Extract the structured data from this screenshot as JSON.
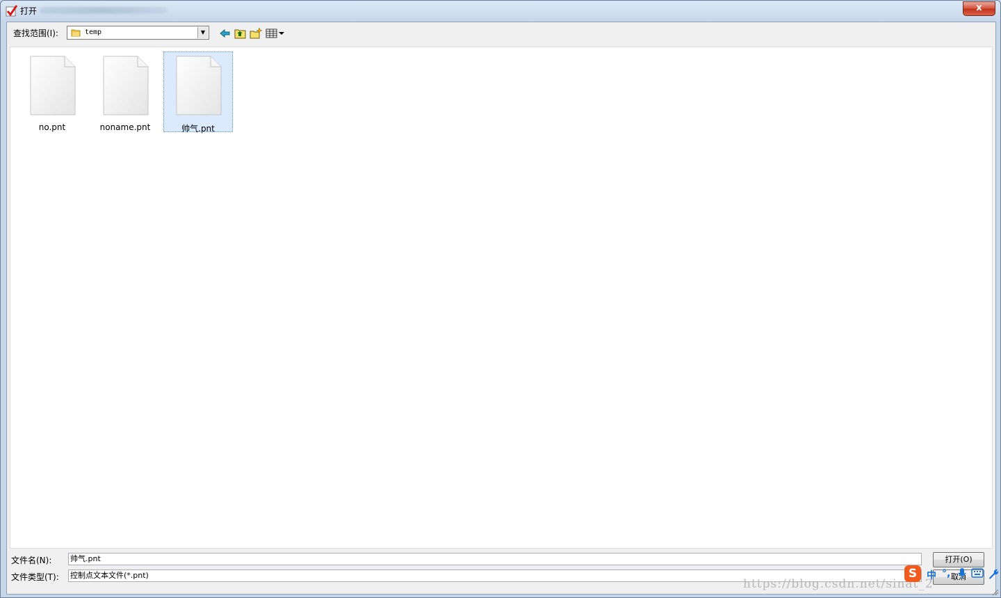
{
  "window": {
    "title": "打开",
    "close_label": "x"
  },
  "toolbar": {
    "lookin_label": "查找范围(I):",
    "lookin_value": "temp",
    "buttons": [
      "back-icon",
      "up-folder-icon",
      "new-folder-icon",
      "view-menu-icon"
    ]
  },
  "files": [
    {
      "name": "no.pnt",
      "selected": false
    },
    {
      "name": "noname.pnt",
      "selected": false
    },
    {
      "name": "帅气.pnt",
      "selected": true
    }
  ],
  "form": {
    "filename_label": "文件名(N):",
    "filename_value": "帅气.pnt",
    "filetype_label": "文件类型(T):",
    "filetype_value": "控制点文本文件(*.pnt)",
    "open_button": "打开(O)",
    "cancel_button": "取消"
  },
  "ime": {
    "logo": "S",
    "mode": "中",
    "punct": "°,"
  },
  "watermark": "https://blog.csdn.net/sinat_2"
}
